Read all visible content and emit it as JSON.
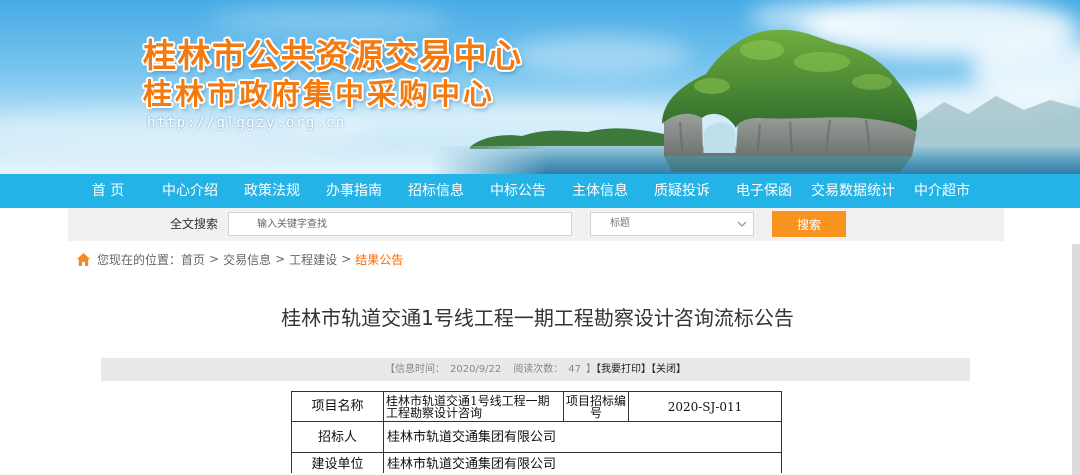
{
  "colors": {
    "nav_bg": "#23b3e6",
    "search_button": "#f7931e",
    "breadcrumb_current": "#ff6a00",
    "banner_title": "#f47a10",
    "home_icon": "#f08a24"
  },
  "banner": {
    "title": "桂林市公共资源交易中心",
    "subtitle": "桂林市政府集中采购中心",
    "url": "http://glggzy.org.cn"
  },
  "nav": {
    "items": [
      "首 页",
      "中心介绍",
      "政策法规",
      "办事指南",
      "招标信息",
      "中标公告",
      "主体信息",
      "质疑投诉",
      "电子保函",
      "交易数据统计",
      "中介超市"
    ]
  },
  "search": {
    "label": "全文搜索",
    "placeholder": "输入关键字查找",
    "field_selected": "标题",
    "field_icon": "chevron-down-icon",
    "button": "搜索"
  },
  "breadcrumb": {
    "icon": "home-icon",
    "prefix": "您现在的位置：",
    "separator": ">",
    "items": [
      "首页",
      "交易信息",
      "工程建设",
      "结果公告"
    ]
  },
  "article": {
    "title": "桂林市轨道交通1号线工程一期工程勘察设计咨询流标公告",
    "meta": {
      "time_label": "【信息时间：",
      "time": "2020/9/22",
      "reads_label": "阅读次数：",
      "reads": "47",
      "close_bracket": "】",
      "print": "【我要打印】",
      "close": "【关闭】"
    },
    "table": {
      "rows": [
        {
          "label": "项目名称",
          "value": "桂林市轨道交通1号线工程一期工程勘察设计咨询",
          "label2": "项目招标编号",
          "value2": "2020-SJ-011"
        },
        {
          "label": "招标人",
          "value": "桂林市轨道交通集团有限公司"
        },
        {
          "label": "建设单位",
          "value": "桂林市轨道交通集团有限公司"
        }
      ]
    }
  }
}
